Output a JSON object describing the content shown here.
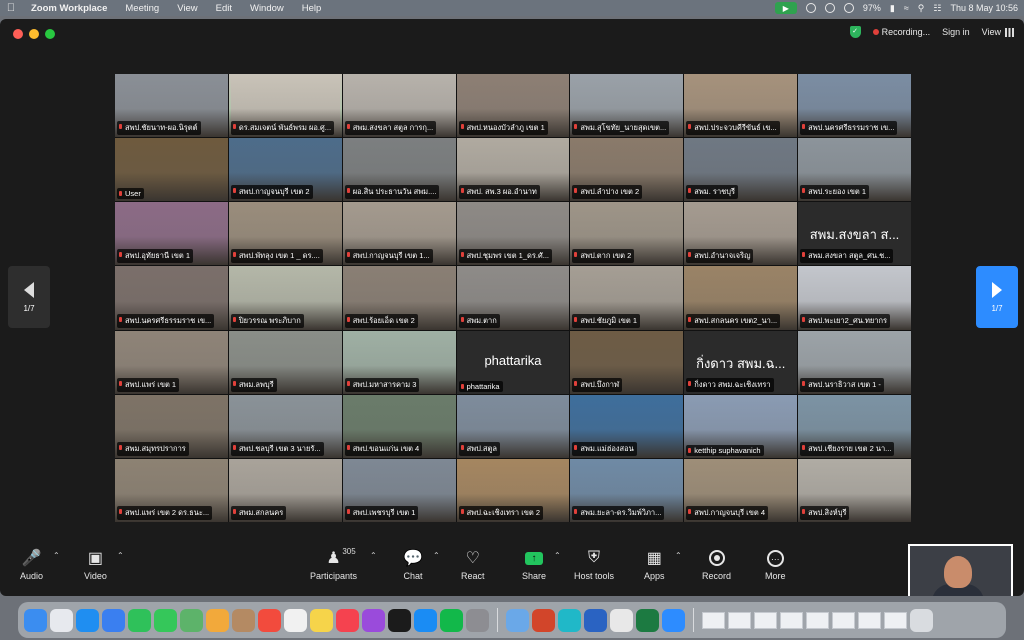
{
  "menubar": {
    "app": "Zoom Workplace",
    "items": [
      "Meeting",
      "View",
      "Edit",
      "Window",
      "Help"
    ],
    "battery": "97%",
    "datetime": "Thu 8 May  10:56"
  },
  "window": {
    "recording": "Recording...",
    "sign_in": "Sign in",
    "view": "View"
  },
  "gallery": {
    "page_indicator": "1/7",
    "tiles": [
      {
        "name": "สพป.ชัยนาท-ผอ.นิรุตต์",
        "bg": "#8a8f96"
      },
      {
        "name": "ดร.สมเจตน์ พันธ์พรม ผอ.ศู...",
        "bg": "#c9c3b8",
        "speaking": true
      },
      {
        "name": "สพม.สงขลา สตูล การกุ...",
        "bg": "#b7b2ab"
      },
      {
        "name": "สพป.หนองบัวลำภู เขต 1",
        "bg": "#8d7f74"
      },
      {
        "name": "สพม.สุโขทัย_นายสุดเขต...",
        "bg": "#9aa1a8"
      },
      {
        "name": "สพป.ประจวบคีรีขันธ์ เข...",
        "bg": "#a6927c"
      },
      {
        "name": "สพป.นครศรีธรรมราช เข...",
        "bg": "#7b8da3"
      },
      {
        "name": "User",
        "bg": "#6e5a3e"
      },
      {
        "name": "สพป.กาญจนบุรี เขต 2",
        "bg": "#4d6c8a"
      },
      {
        "name": "ผอ.สิน ประธานวัน สพม....",
        "bg": "#7c7f80"
      },
      {
        "name": "สพป. สพ.3 ผอ.อำนาท",
        "bg": "#b0aaa0"
      },
      {
        "name": "สพป.ลำปาง เขต 2",
        "bg": "#8a7a6a"
      },
      {
        "name": "สพม. ราชบุรี",
        "bg": "#6f7883"
      },
      {
        "name": "สพป.ระยอง เขต 1",
        "bg": "#8c949b"
      },
      {
        "name": "สพป.อุทัยธานี เขต 1",
        "bg": "#8c6b86"
      },
      {
        "name": "สพป.พัทลุง เขต 1 _ ดร....",
        "bg": "#9a8d7c"
      },
      {
        "name": "สพป.กาญจนบุรี เขต 1...",
        "bg": "#a49a8e"
      },
      {
        "name": "สพป.ชุมพร เขต 1_ดร.ศั...",
        "bg": "#8e8a86"
      },
      {
        "name": "สพป.ตาก เขต 2",
        "bg": "#9e9588"
      },
      {
        "name": "สพป.อำนาจเจริญ",
        "bg": "#a59b90"
      },
      {
        "name": "สพม.สงขลา สตูล_ศน.ช...",
        "bg": "#2b2b2b",
        "big": "สพม.สงขลา ส...",
        "dark": true
      },
      {
        "name": "สพป.นครศรีธรรมราช เข...",
        "bg": "#7b6f6a"
      },
      {
        "name": "ปิยวรรณ พระภิบาก",
        "bg": "#b4b7a8"
      },
      {
        "name": "สพป.ร้อยเอ็ด เขต 2",
        "bg": "#8a7f74"
      },
      {
        "name": "สพม.ตาก",
        "bg": "#8e8b88"
      },
      {
        "name": "สพป.ชัยภูมิ เขต 1",
        "bg": "#a59e94"
      },
      {
        "name": "สพป.สกลนคร เขต2_นา...",
        "bg": "#9a8366"
      },
      {
        "name": "สพป.พะเยา2_ศน.ทยากร",
        "bg": "#c3c6cc"
      },
      {
        "name": "สพป.แพร่ เขต 1",
        "bg": "#8f8478"
      },
      {
        "name": "สพม.ลพบุรี",
        "bg": "#8a8e88"
      },
      {
        "name": "สพป.มหาสารคาม 3",
        "bg": "#9fb0a4"
      },
      {
        "name": "phattarika",
        "bg": "#2b2b2b",
        "big": "phattarika",
        "dark": true
      },
      {
        "name": "สพป.บึงกาฬ",
        "bg": "#6e5c45"
      },
      {
        "name": "กิ่งดาว สพม.ฉะเชิงเทรา",
        "bg": "#2b2b2b",
        "big": "กิ่งดาว สพม.ฉ...",
        "dark": true
      },
      {
        "name": "สพป.นราธิวาส เขต 1 -",
        "bg": "#9ca3a8"
      },
      {
        "name": "สพม.สมุทรปราการ",
        "bg": "#7e7366"
      },
      {
        "name": "สพป.ชลบุรี เขต 3 นายรั...",
        "bg": "#8a9298"
      },
      {
        "name": "สพป.ขอนแก่น เขต 4",
        "bg": "#6a7c6a"
      },
      {
        "name": "สพป.สตูล",
        "bg": "#7e8c9c"
      },
      {
        "name": "สพม.แม่ฮ่องสอน",
        "bg": "#3e6e9c"
      },
      {
        "name": "ketthip suphavanich",
        "bg": "#8a9bb3"
      },
      {
        "name": "สพป.เชียงราย เขต 2 นา...",
        "bg": "#7c93a4"
      },
      {
        "name": "สพป.แพร่ เขต 2 ดร.ธนะ...",
        "bg": "#8d8273"
      },
      {
        "name": "สพม.สกลนคร",
        "bg": "#a9a39a"
      },
      {
        "name": "สพป.เพชรบุรี เขต 1",
        "bg": "#7e8894"
      },
      {
        "name": "สพป.ฉะเชิงเทรา เขต 2",
        "bg": "#a58660"
      },
      {
        "name": "สพม.ยะลา-ดร.วิมพ์วิภา...",
        "bg": "#6f8aa5"
      },
      {
        "name": "สพป.กาญจนบุรี เขต 4",
        "bg": "#9e8e78"
      },
      {
        "name": "สพป.สิงห์บุรี",
        "bg": "#b0aca4"
      }
    ]
  },
  "toolbar": {
    "audio": "Audio",
    "video": "Video",
    "participants": "Participants",
    "participant_count": "305",
    "chat": "Chat",
    "react": "React",
    "share": "Share",
    "host_tools": "Host tools",
    "apps": "Apps",
    "record": "Record",
    "more": "More"
  },
  "dock": {
    "apps": [
      "finder",
      "launchpad",
      "safari",
      "mail",
      "facetime",
      "messages",
      "maps",
      "photos",
      "contacts",
      "calendar",
      "reminders",
      "notes",
      "music",
      "podcasts",
      "tv",
      "app-store",
      "line",
      "system-settings",
      "preview",
      "powerpoint",
      "canva",
      "word",
      "chrome",
      "excel",
      "zoom"
    ],
    "app_colors": [
      "#3b8df0",
      "#e7e9ee",
      "#1f8ef1",
      "#3a7ff0",
      "#2fc15a",
      "#35c75a",
      "#5db36a",
      "#f2a93b",
      "#b48a63",
      "#f24b3d",
      "#f1f1f1",
      "#f6d44a",
      "#f5424f",
      "#9a4bdb",
      "#1b1b1b",
      "#1a8cf4",
      "#12b84a",
      "#8d8d92",
      "#6aa8e8",
      "#d2452a",
      "#20b8c8",
      "#2a63c2",
      "#e8e8e8",
      "#1c7a41",
      "#2d8cff"
    ]
  }
}
